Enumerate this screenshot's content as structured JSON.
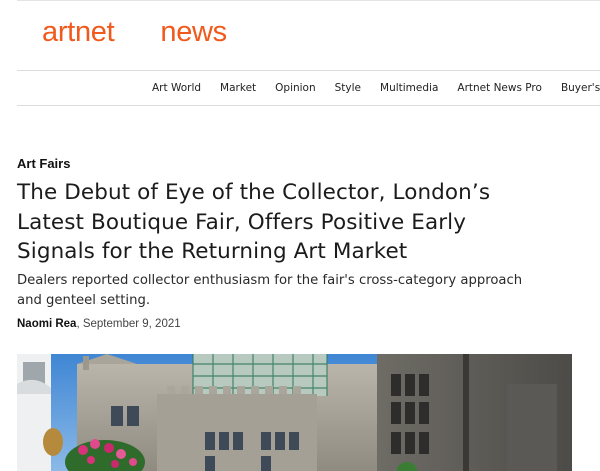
{
  "brand": {
    "logo_word_1": "artnet",
    "logo_word_2": "news",
    "accent_color": "#f05a1c"
  },
  "nav": {
    "items": [
      {
        "label": "Art World"
      },
      {
        "label": "Market"
      },
      {
        "label": "Opinion"
      },
      {
        "label": "Style"
      },
      {
        "label": "Multimedia"
      },
      {
        "label": "Artnet News Pro"
      },
      {
        "label": "Buyer's G"
      }
    ]
  },
  "article": {
    "category": "Art Fairs",
    "headline_lines": [
      "The Debut of Eye of the Collector, London’s",
      "Latest Boutique Fair, Offers Positive Early",
      "Signals for the Returning Art Market"
    ],
    "dek_lines": [
      "Dealers reported collector enthusiasm for the fair's cross-category approach",
      "and genteel setting."
    ],
    "author": "Naomi Rea",
    "date_text": ", September 9, 2021"
  }
}
